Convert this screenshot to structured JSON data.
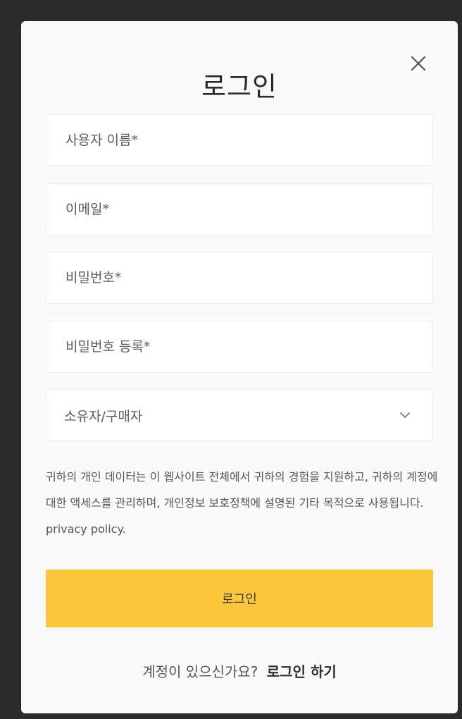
{
  "modal": {
    "title": "로그인",
    "close_icon": "close-icon"
  },
  "form": {
    "username_placeholder": "사용자 이름*",
    "email_placeholder": "이메일*",
    "password_placeholder": "비밀번호*",
    "password_confirm_placeholder": "비밀번호 등록*",
    "role_select_value": "소유자/구매자",
    "role_select_icon": "chevron-down-icon",
    "privacy_notice": "귀하의 개인 데이터는 이 웹사이트 전체에서 귀하의 경험을 지원하고, 귀하의 계정에 대한 액세스를 관리하며, 개인정보 보호정책에 설명된 기타 목적으로 사용됩니다. privacy policy.",
    "submit_label": "로그인"
  },
  "footer": {
    "prompt": "계정이 있으신가요?",
    "link_label": "로그인 하기"
  },
  "colors": {
    "accent": "#fbc63a",
    "backdrop": "#2b2b2b",
    "modal_bg": "#fafafa"
  }
}
